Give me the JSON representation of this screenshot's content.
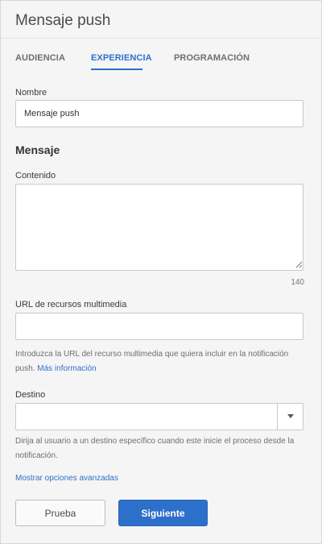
{
  "panel": {
    "title": "Mensaje push"
  },
  "tabs": [
    {
      "label": "AUDIENCIA",
      "active": false
    },
    {
      "label": "EXPERIENCIA",
      "active": true
    },
    {
      "label": "PROGRAMACIÓN",
      "active": false
    }
  ],
  "form": {
    "name": {
      "label": "Nombre",
      "value": "Mensaje push"
    },
    "message_heading": "Mensaje",
    "content": {
      "label": "Contenido",
      "value": "",
      "remaining_chars": "140"
    },
    "media_url": {
      "label": "URL de recursos multimedia",
      "value": "",
      "help_text": "Introduzca la URL del recurso multimedia que quiera incluir en la notificación push.",
      "help_link": "Más información"
    },
    "destination": {
      "label": "Destino",
      "selected": "",
      "help_text": "Dirija al usuario a un destino específico cuando este inicie el proceso desde la notificación."
    },
    "advanced_link": "Mostrar opciones avanzadas"
  },
  "actions": {
    "test_label": "Prueba",
    "next_label": "Siguiente"
  },
  "colors": {
    "accent": "#2d70c9",
    "panel_bg": "#f5f5f5",
    "border": "#c9c9c9"
  }
}
